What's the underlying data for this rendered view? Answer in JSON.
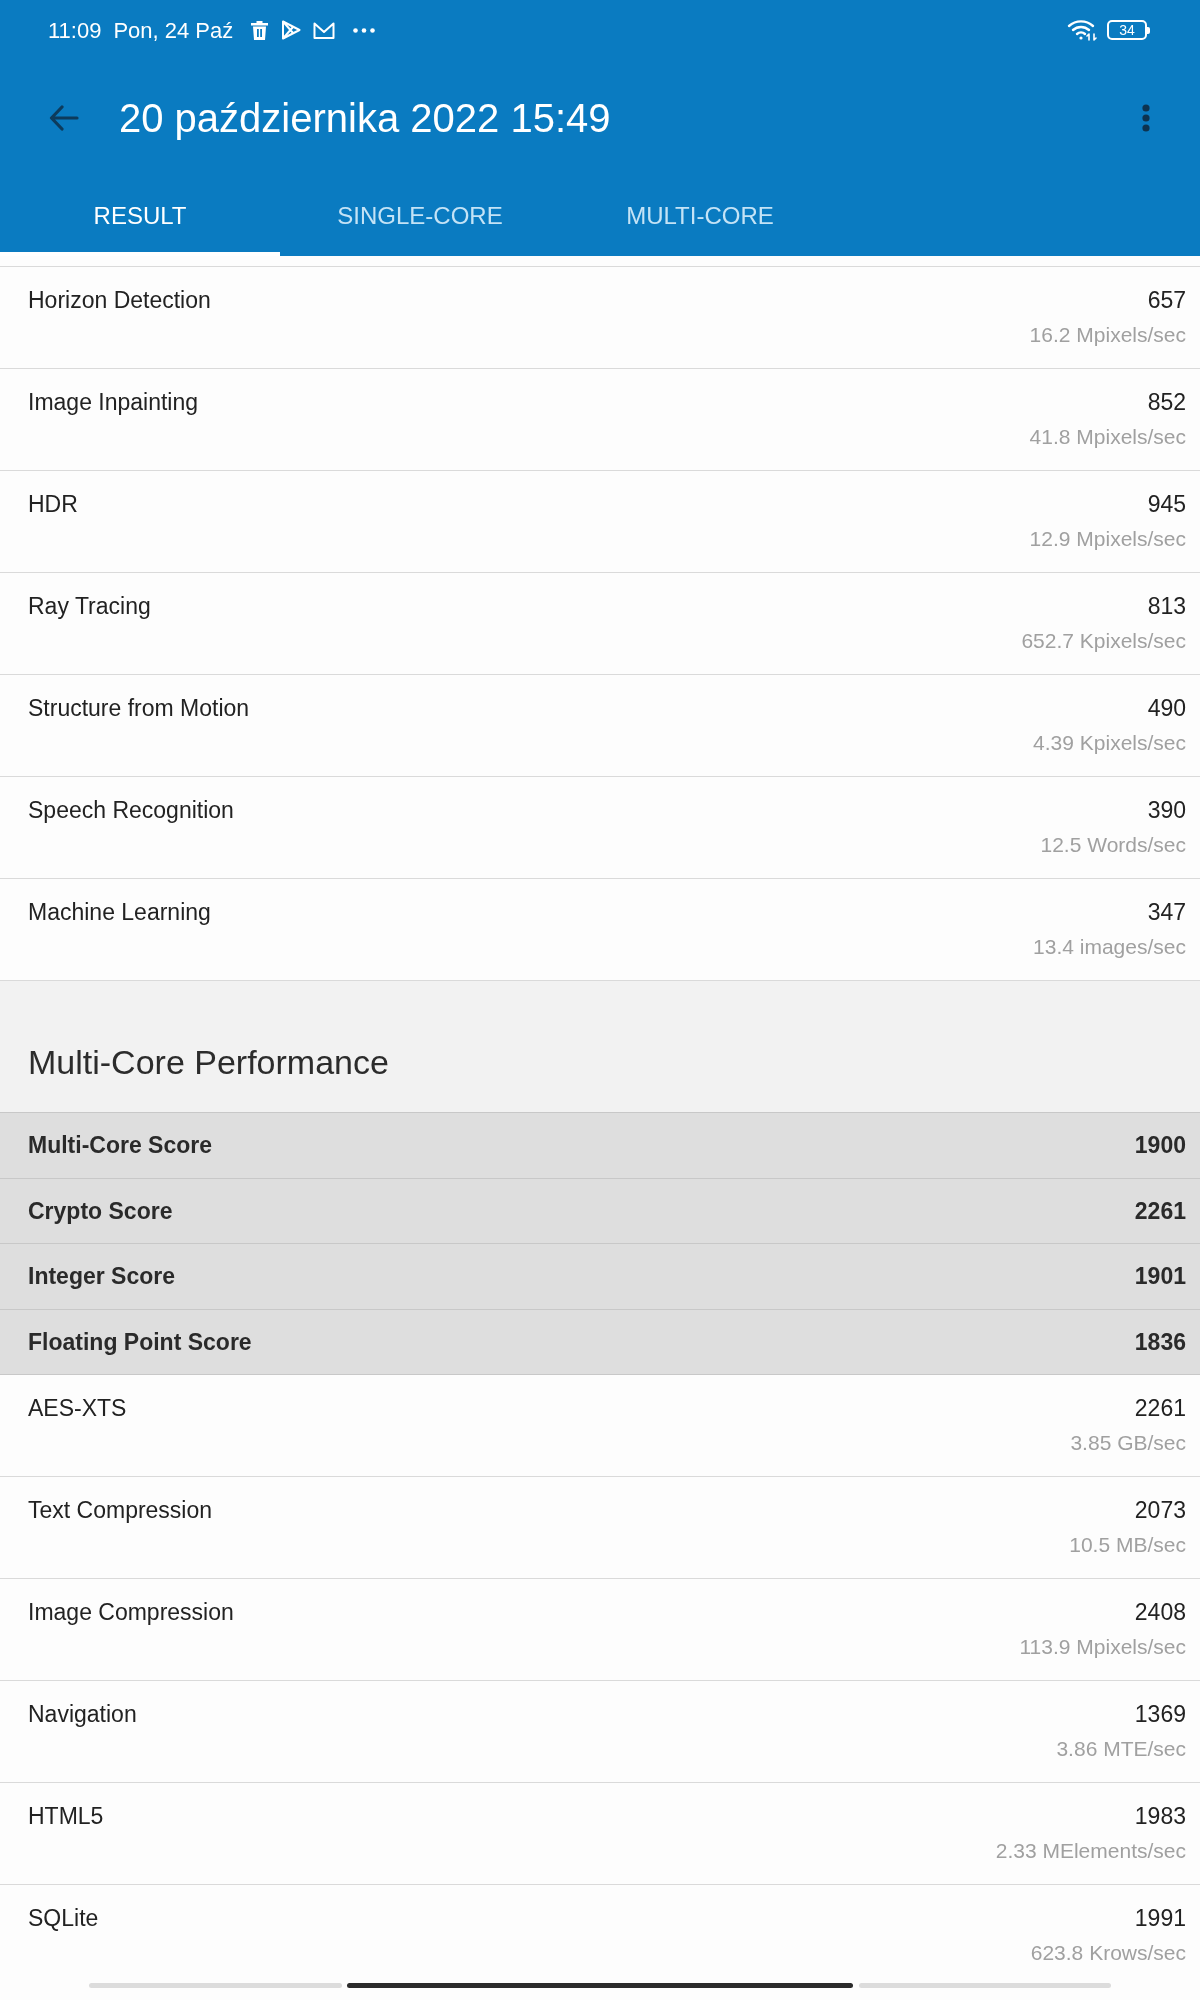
{
  "status_bar": {
    "time": "11:09",
    "date": "Pon, 24 Paź",
    "battery": "34"
  },
  "app_bar": {
    "title": "20 października 2022 15:49"
  },
  "tabs": [
    {
      "label": "RESULT",
      "selected": true
    },
    {
      "label": "SINGLE-CORE",
      "selected": false
    },
    {
      "label": "MULTI-CORE",
      "selected": false
    }
  ],
  "result_rows": [
    {
      "name": "Horizon Detection",
      "score": "657",
      "rate": "16.2 Mpixels/sec"
    },
    {
      "name": "Image Inpainting",
      "score": "852",
      "rate": "41.8 Mpixels/sec"
    },
    {
      "name": "HDR",
      "score": "945",
      "rate": "12.9 Mpixels/sec"
    },
    {
      "name": "Ray Tracing",
      "score": "813",
      "rate": "652.7 Kpixels/sec"
    },
    {
      "name": "Structure from Motion",
      "score": "490",
      "rate": "4.39 Kpixels/sec"
    },
    {
      "name": "Speech Recognition",
      "score": "390",
      "rate": "12.5 Words/sec"
    },
    {
      "name": "Machine Learning",
      "score": "347",
      "rate": "13.4 images/sec"
    }
  ],
  "multi_core": {
    "title": "Multi-Core Performance",
    "scores": [
      {
        "name": "Multi-Core Score",
        "score": "1900"
      },
      {
        "name": "Crypto Score",
        "score": "2261"
      },
      {
        "name": "Integer Score",
        "score": "1901"
      },
      {
        "name": "Floating Point Score",
        "score": "1836"
      }
    ],
    "results": [
      {
        "name": "AES-XTS",
        "score": "2261",
        "rate": "3.85 GB/sec"
      },
      {
        "name": "Text Compression",
        "score": "2073",
        "rate": "10.5 MB/sec"
      },
      {
        "name": "Image Compression",
        "score": "2408",
        "rate": "113.9 Mpixels/sec"
      },
      {
        "name": "Navigation",
        "score": "1369",
        "rate": "3.86 MTE/sec"
      },
      {
        "name": "HTML5",
        "score": "1983",
        "rate": "2.33 MElements/sec"
      },
      {
        "name": "SQLite",
        "score": "1991",
        "rate": "623.8 Krows/sec"
      }
    ]
  }
}
